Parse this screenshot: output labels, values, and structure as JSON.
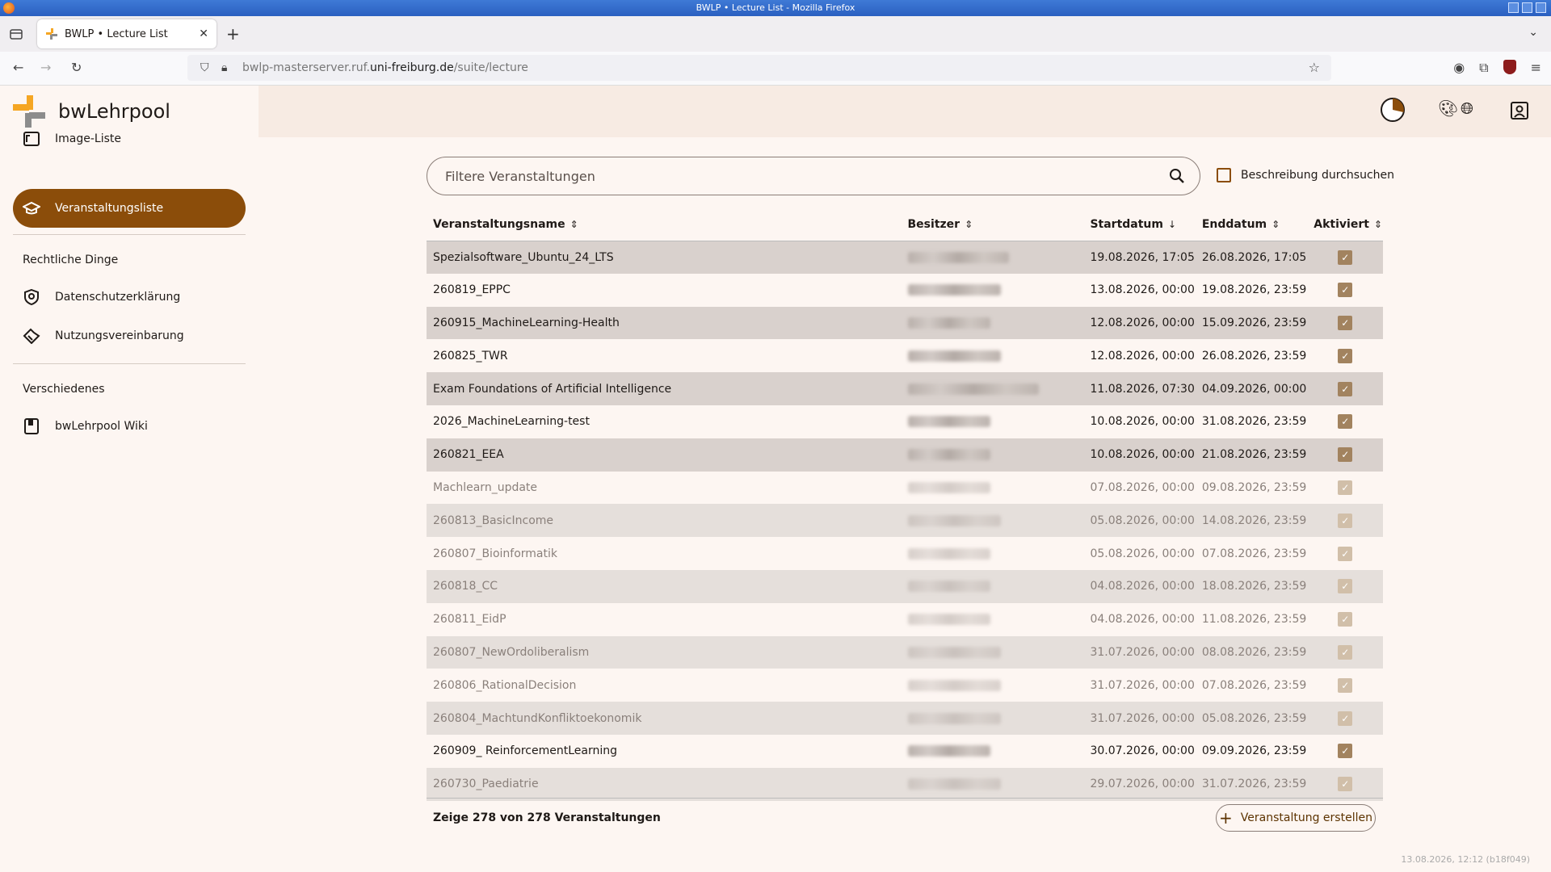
{
  "window": {
    "title": "BWLP • Lecture List - Mozilla Firefox"
  },
  "browser": {
    "tab_title": "BWLP • Lecture List",
    "url_prefix": "bwlp-masterserver.ruf.",
    "url_domain": "uni-freiburg.de",
    "url_path": "/suite/lecture"
  },
  "app": {
    "brand": "bwLehrpool",
    "nav": {
      "image_list": "Image-Liste",
      "lecture_list": "Veranstaltungsliste",
      "legal_header": "Rechtliche Dinge",
      "privacy": "Datenschutzerklärung",
      "terms": "Nutzungsvereinbarung",
      "misc_header": "Verschiedenes",
      "wiki": "bwLehrpool Wiki"
    },
    "search": {
      "placeholder": "Filtere Veranstaltungen",
      "desc_checkbox_label": "Beschreibung durchsuchen"
    },
    "table": {
      "headers": {
        "name": "Veranstaltungsname",
        "owner": "Besitzer",
        "start": "Startdatum",
        "end": "Enddatum",
        "active": "Aktiviert"
      },
      "sort_icons": {
        "name": "⇕",
        "owner": "⇕",
        "start": "↓",
        "end": "⇕",
        "active": "⇕"
      },
      "rows": [
        {
          "name": "Spezialsoftware_Ubuntu_24_LTS",
          "start": "19.08.2026, 17:05",
          "end": "26.08.2026, 17:05",
          "active": true,
          "current": true,
          "blur_w": 125
        },
        {
          "name": "260819_EPPC",
          "start": "13.08.2026, 00:00",
          "end": "19.08.2026, 23:59",
          "active": true,
          "current": true,
          "blur_w": 115
        },
        {
          "name": "260915_MachineLearning-Health",
          "start": "12.08.2026, 00:00",
          "end": "15.09.2026, 23:59",
          "active": true,
          "current": true,
          "blur_w": 102
        },
        {
          "name": "260825_TWR",
          "start": "12.08.2026, 00:00",
          "end": "26.08.2026, 23:59",
          "active": true,
          "current": true,
          "blur_w": 115
        },
        {
          "name": "Exam Foundations of Artificial Intelligence",
          "start": "11.08.2026, 07:30",
          "end": "04.09.2026, 00:00",
          "active": true,
          "current": true,
          "blur_w": 162
        },
        {
          "name": "2026_MachineLearning-test",
          "start": "10.08.2026, 00:00",
          "end": "31.08.2026, 23:59",
          "active": true,
          "current": true,
          "blur_w": 102
        },
        {
          "name": "260821_EEA",
          "start": "10.08.2026, 00:00",
          "end": "21.08.2026, 23:59",
          "active": true,
          "current": true,
          "blur_w": 102
        },
        {
          "name": "Machlearn_update",
          "start": "07.08.2026, 00:00",
          "end": "09.08.2026, 23:59",
          "active": true,
          "current": false,
          "blur_w": 102
        },
        {
          "name": "260813_BasicIncome",
          "start": "05.08.2026, 00:00",
          "end": "14.08.2026, 23:59",
          "active": true,
          "current": false,
          "blur_w": 115
        },
        {
          "name": "260807_Bioinformatik",
          "start": "05.08.2026, 00:00",
          "end": "07.08.2026, 23:59",
          "active": true,
          "current": false,
          "blur_w": 102
        },
        {
          "name": "260818_CC",
          "start": "04.08.2026, 00:00",
          "end": "18.08.2026, 23:59",
          "active": true,
          "current": false,
          "blur_w": 102
        },
        {
          "name": "260811_EidP",
          "start": "04.08.2026, 00:00",
          "end": "11.08.2026, 23:59",
          "active": true,
          "current": false,
          "blur_w": 102
        },
        {
          "name": "260807_NewOrdoliberalism",
          "start": "31.07.2026, 00:00",
          "end": "08.08.2026, 23:59",
          "active": true,
          "current": false,
          "blur_w": 115
        },
        {
          "name": "260806_RationalDecision",
          "start": "31.07.2026, 00:00",
          "end": "07.08.2026, 23:59",
          "active": true,
          "current": false,
          "blur_w": 115
        },
        {
          "name": "260804_MachtundKonfliktoekonomik",
          "start": "31.07.2026, 00:00",
          "end": "05.08.2026, 23:59",
          "active": true,
          "current": false,
          "blur_w": 115
        },
        {
          "name": "260909_ ReinforcementLearning",
          "start": "30.07.2026, 00:00",
          "end": "09.09.2026, 23:59",
          "active": true,
          "current": true,
          "blur_w": 102
        },
        {
          "name": "260730_Paediatrie",
          "start": "29.07.2026, 00:00",
          "end": "31.07.2026, 23:59",
          "active": true,
          "current": false,
          "blur_w": 115
        }
      ]
    },
    "footer": {
      "count_text": "Zeige 278 von 278 Veranstaltungen",
      "create_button": "Veranstaltung erstellen",
      "version": "13.08.2026, 12:12 (b18f049)"
    },
    "icons": {
      "theme": "palette-icon",
      "language": "globe-icon",
      "account": "account-box-icon",
      "status": "pie-status-icon"
    },
    "colors": {
      "accent": "#8b4d0a",
      "logo_orange": "#f5a623",
      "logo_gray": "#8c8c8c"
    }
  }
}
